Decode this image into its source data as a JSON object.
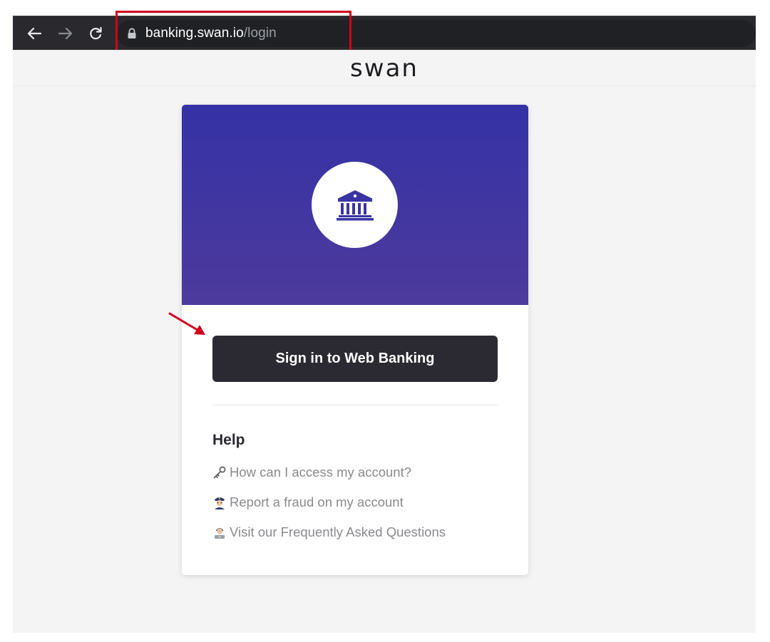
{
  "browser": {
    "url_host": "banking.swan.io",
    "url_path": "/login",
    "back_icon": "arrow-left-icon",
    "forward_icon": "arrow-right-icon",
    "reload_icon": "reload-icon",
    "lock_icon": "lock-icon"
  },
  "header": {
    "logo_text": "swan"
  },
  "card": {
    "hero_icon": "bank-icon",
    "hero_gradient": [
      "#3532a6",
      "#4d3a9c"
    ],
    "signin_label": "Sign in to Web Banking",
    "help": {
      "title": "Help",
      "links": [
        {
          "icon": "key-icon",
          "label": "How can I access my account?"
        },
        {
          "icon": "police-officer-icon",
          "label": "Report a fraud on my account"
        },
        {
          "icon": "technologist-icon",
          "label": "Visit our Frequently Asked Questions"
        }
      ]
    }
  },
  "annotations": {
    "color": "#d0021b"
  }
}
